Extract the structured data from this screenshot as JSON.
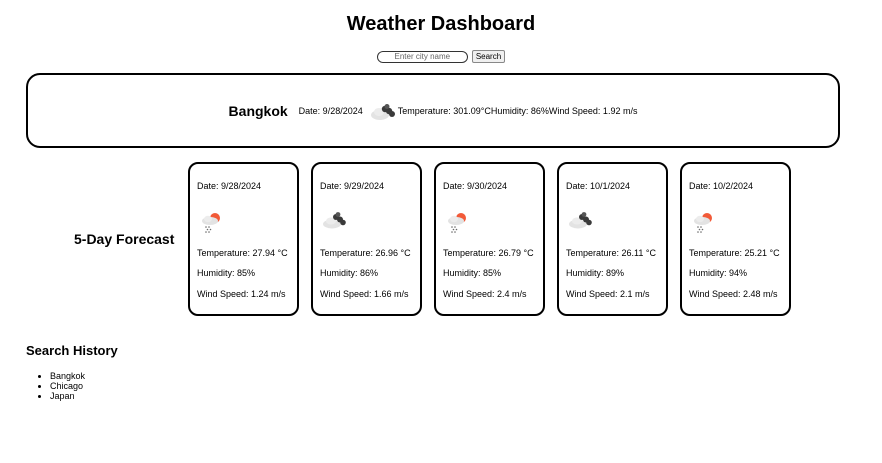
{
  "header": {
    "title": "Weather Dashboard"
  },
  "search": {
    "placeholder": "Enter city name",
    "button_label": "Search"
  },
  "current": {
    "city": "Bangkok",
    "date": "Date: 9/28/2024",
    "icon": "broken-clouds-icon",
    "details": "Temperature: 301.09°CHumidity: 86%Wind Speed: 1.92 m/s"
  },
  "forecast": {
    "title": "5-Day Forecast",
    "days": [
      {
        "date": "Date: 9/28/2024",
        "icon": "rain-icon",
        "temperature": "Temperature: 27.94 °C",
        "humidity": "Humidity: 85%",
        "wind": "Wind Speed: 1.24 m/s"
      },
      {
        "date": "Date: 9/29/2024",
        "icon": "broken-clouds-icon",
        "temperature": "Temperature: 26.96 °C",
        "humidity": "Humidity: 86%",
        "wind": "Wind Speed: 1.66 m/s"
      },
      {
        "date": "Date: 9/30/2024",
        "icon": "rain-icon",
        "temperature": "Temperature: 26.79 °C",
        "humidity": "Humidity: 85%",
        "wind": "Wind Speed: 2.4 m/s"
      },
      {
        "date": "Date: 10/1/2024",
        "icon": "broken-clouds-icon",
        "temperature": "Temperature: 26.11 °C",
        "humidity": "Humidity: 89%",
        "wind": "Wind Speed: 2.1 m/s"
      },
      {
        "date": "Date: 10/2/2024",
        "icon": "rain-icon",
        "temperature": "Temperature: 25.21 °C",
        "humidity": "Humidity: 94%",
        "wind": "Wind Speed: 2.48 m/s"
      }
    ]
  },
  "history": {
    "title": "Search History",
    "items": [
      "Bangkok",
      "Chicago",
      "Japan"
    ]
  },
  "colors": {
    "border": "#000000",
    "sun": "#f25a38",
    "cloud_light": "#e3e3e3",
    "cloud_dark": "#3a3a3a"
  }
}
